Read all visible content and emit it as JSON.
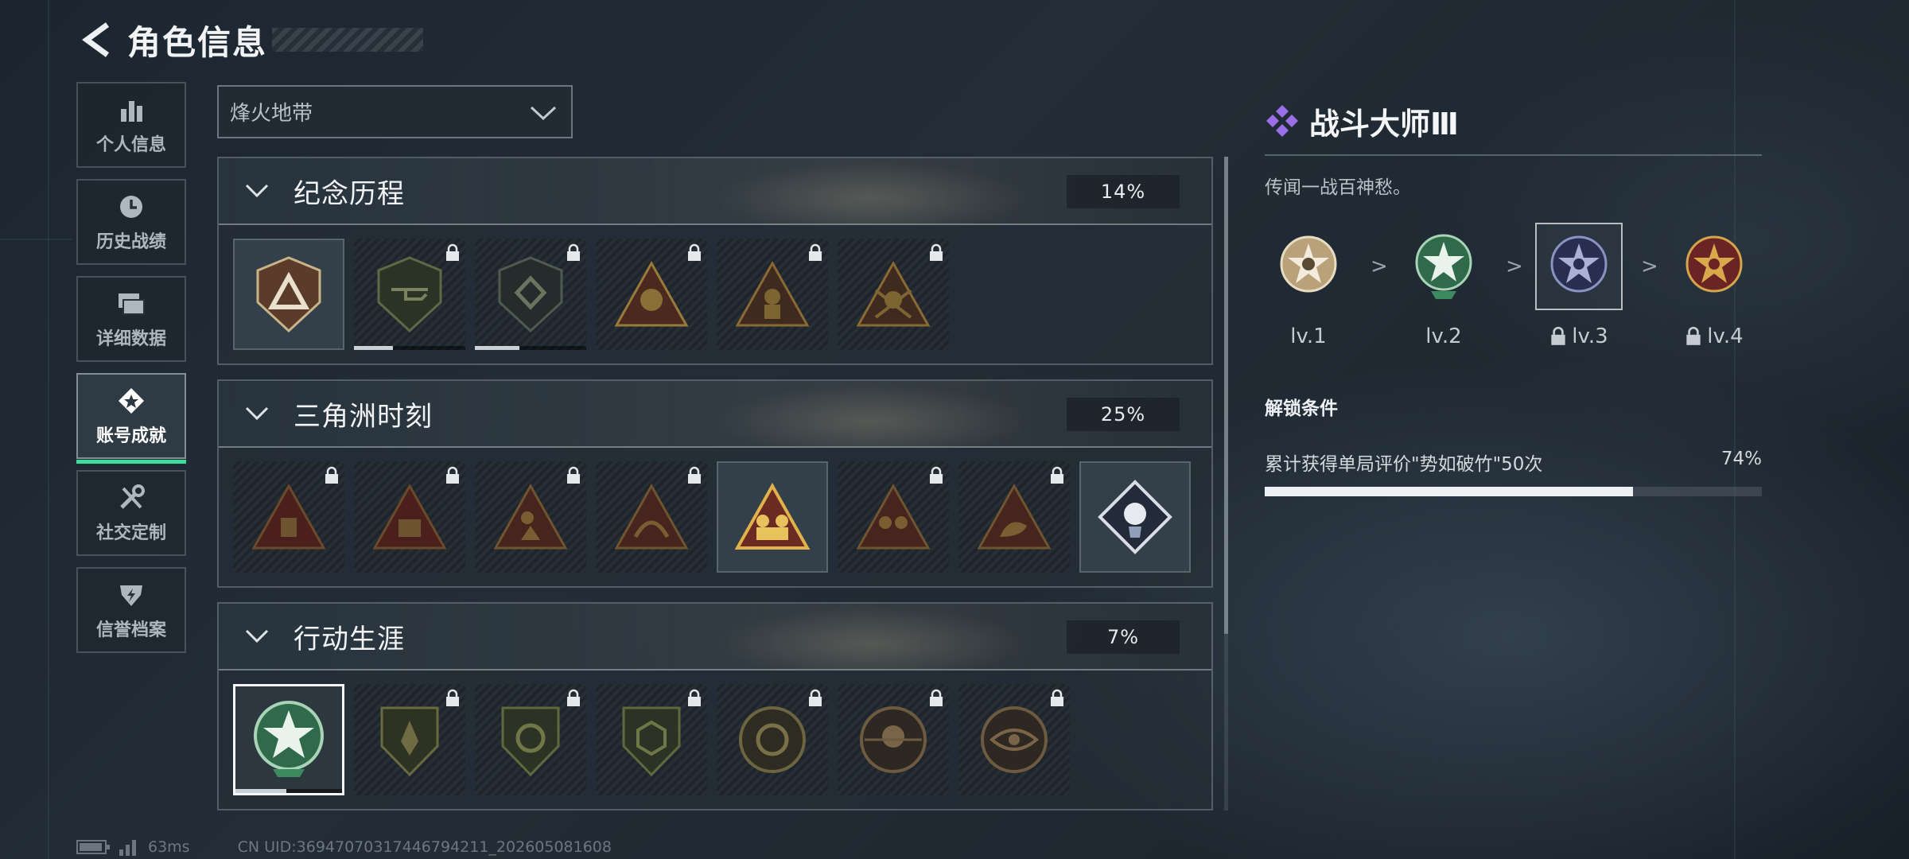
{
  "header": {
    "title": "角色信息"
  },
  "nav": {
    "items": [
      {
        "label": "个人信息",
        "icon": "bar-chart-icon"
      },
      {
        "label": "历史战绩",
        "icon": "clock-icon"
      },
      {
        "label": "详细数据",
        "icon": "folder-icon"
      },
      {
        "label": "账号成就",
        "icon": "achievement-icon",
        "active": true
      },
      {
        "label": "社交定制",
        "icon": "tools-icon"
      },
      {
        "label": "信誉档案",
        "icon": "shield-icon"
      }
    ]
  },
  "mode_select": {
    "value": "烽火地带"
  },
  "sections": [
    {
      "title": "纪念历程",
      "percent": "14%"
    },
    {
      "title": "三角洲时刻",
      "percent": "25%"
    },
    {
      "title": "行动生涯",
      "percent": "7%"
    }
  ],
  "detail": {
    "title": "战斗大师Ⅲ",
    "description": "传闻一战百神愁。",
    "levels": [
      {
        "label": "lv.1",
        "locked": false
      },
      {
        "label": "lv.2",
        "locked": false
      },
      {
        "label": "lv.3",
        "locked": true,
        "current": true
      },
      {
        "label": "lv.4",
        "locked": true
      }
    ],
    "separator": ">",
    "condition_title": "解锁条件",
    "condition_text": "累计获得单局评价\"势如破竹\"50次",
    "condition_percent": "74%",
    "condition_progress": 0.74
  },
  "footer": {
    "latency": "63ms",
    "uid": "CN UID:36947070317446794211_202605081608"
  },
  "colors": {
    "accent": "#3ddc9b",
    "purple_icon": "#9b6fe8"
  }
}
